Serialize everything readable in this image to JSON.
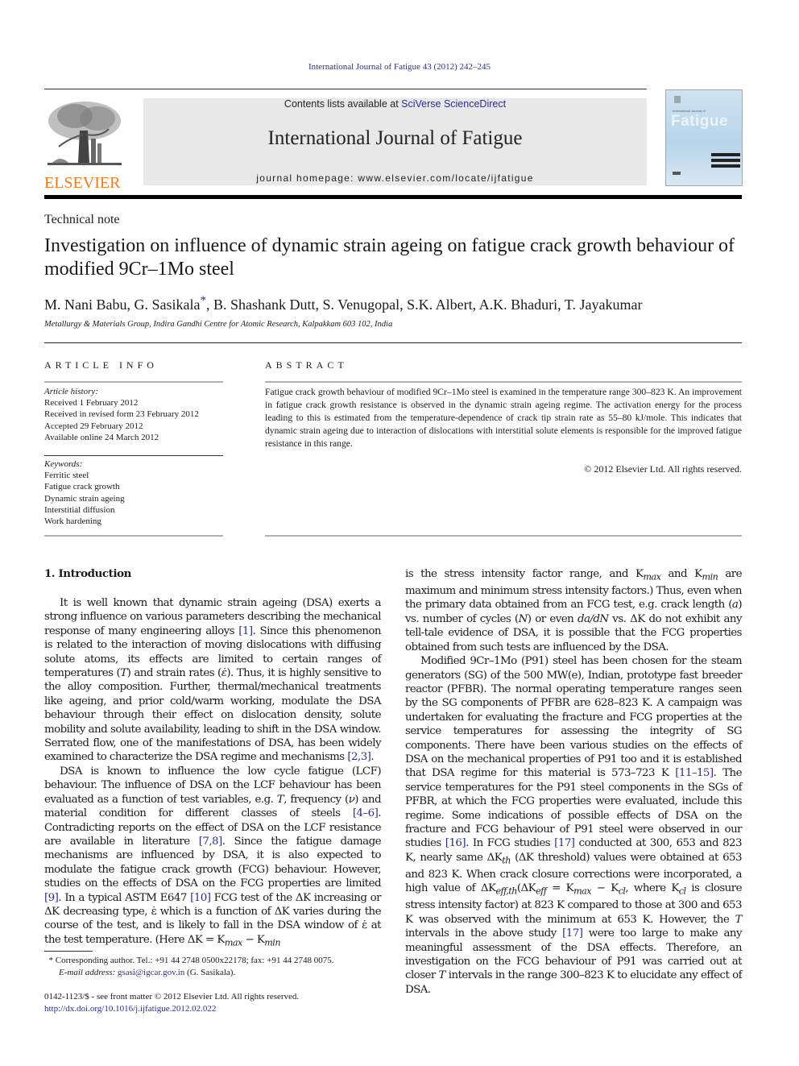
{
  "header": {
    "journal_reference": "International Journal of Fatigue 43 (2012) 242–245",
    "contents_prefix": "Contents lists available at ",
    "contents_link": "SciVerse ScienceDirect",
    "journal_title": "International Journal of Fatigue",
    "homepage": "journal homepage: www.elsevier.com/locate/ijfatigue",
    "publisher_logo_text": "ELSEVIER",
    "cover": {
      "small_title": "International Journal of",
      "big_title": "Fatigue"
    },
    "colors": {
      "link": "#2b2e8c",
      "elsevier_orange": "#f07c22",
      "banner_bg": "#e8e8e8"
    }
  },
  "article": {
    "type": "Technical note",
    "title": "Investigation on influence of dynamic strain ageing on fatigue crack growth behaviour of modified 9Cr–1Mo steel",
    "authors_before": "M. Nani Babu, G. Sasikala",
    "corresponding_mark": "*",
    "authors_after": ", B. Shashank Dutt, S. Venugopal, S.K. Albert, A.K. Bhaduri, T. Jayakumar",
    "affiliation": "Metallurgy & Materials Group, Indira Gandhi Centre for Atomic Research, Kalpakkam 603 102, India"
  },
  "article_info": {
    "heading": "ARTICLE INFO",
    "history_label": "Article history:",
    "history": [
      "Received 1 February 2012",
      "Received in revised form 23 February 2012",
      "Accepted 29 February 2012",
      "Available online 24 March 2012"
    ],
    "keywords_label": "Keywords:",
    "keywords": [
      "Ferritic steel",
      "Fatigue crack growth",
      "Dynamic strain ageing",
      "Interstitial diffusion",
      "Work hardening"
    ]
  },
  "abstract": {
    "heading": "ABSTRACT",
    "text": "Fatigue crack growth behaviour of modified 9Cr–1Mo steel is examined in the temperature range 300–823 K. An improvement in fatigue crack growth resistance is observed in the dynamic strain ageing regime. The activation energy for the process leading to this is estimated from the temperature-dependence of crack tip strain rate as 55–80 kJ/mole. This indicates that dynamic strain ageing due to interaction of dislocations with interstitial solute elements is responsible for the improved fatigue resistance in this range.",
    "copyright": "© 2012 Elsevier Ltd. All rights reserved."
  },
  "body": {
    "section_heading": "1. Introduction",
    "p1": [
      "It is well known that dynamic strain ageing (DSA) exerts a strong influence on various parameters describing the mechanical response of many engineering alloys ",
      "[1]",
      ". Since this phenomenon is related to the interaction of moving dislocations with diffusing solute atoms, its effects are limited to certain ranges of temperatures (",
      "T",
      ") and strain rates (",
      "ε̇",
      "). Thus, it is highly sensitive to the alloy composition. Further, thermal/mechanical treatments like ageing, and prior cold/warm working, modulate the DSA behaviour through their effect on dislocation density, solute mobility and solute availability, leading to shift in the DSA window. Serrated flow, one of the manifestations of DSA, has been widely examined to characterize the DSA regime and mechanisms ",
      "[2,3]",
      "."
    ],
    "p2": [
      "DSA is known to influence the low cycle fatigue (LCF) behaviour. The influence of DSA on the LCF behaviour has been evaluated as a function of test variables, e.g. ",
      "T",
      ", frequency (",
      "ν",
      ") and material condition for different classes of steels ",
      "[4–6]",
      ". Contradicting reports on the effect of DSA on the LCF resistance are available in literature ",
      "[7,8]",
      ". Since the fatigue damage mechanisms are influenced by DSA, it is also expected to modulate the fatigue crack growth (FCG) behaviour. However, studies on the effects of DSA on the FCG properties are limited ",
      "[9]",
      ". In a typical ASTM E647 ",
      "[10]",
      " FCG test of the ΔK increasing or ΔK decreasing type, ε̇ which is a function of ΔK varies during the course of the test, and is likely to fall in the DSA window of ε̇ at the test temperature. (Here ΔK = K",
      "max",
      " − K",
      "min"
    ],
    "p2_cont": [
      "is the stress intensity factor range, and K",
      "max",
      " and K",
      "min",
      " are maximum and minimum stress intensity factors.) Thus, even when the primary data obtained from an FCG test, e.g. crack length (",
      "a",
      ") vs. number of cycles (",
      "N",
      ") or even ",
      "da/dN",
      " vs. ΔK do not exhibit any tell-tale evidence of DSA, it is possible that the FCG properties obtained from such tests are influenced by the DSA."
    ],
    "p3": [
      "Modified 9Cr–1Mo (P91) steel has been chosen for the steam generators (SG) of the 500 MW(e), Indian, prototype fast breeder reactor (PFBR). The normal operating temperature ranges seen by the SG components of PFBR are 628–823 K. A campaign was undertaken for evaluating the fracture and FCG properties at the service temperatures for assessing the integrity of SG components. There have been various studies on the effects of DSA on the mechanical properties of P91 too and it is established that DSA regime for this material is 573–723 K ",
      "[11–15]",
      ". The service temperatures for the P91 steel components in the SGs of PFBR, at which the FCG properties were evaluated, include this regime. Some indications of possible effects of DSA on the fracture and FCG behaviour of P91 steel were observed in our studies ",
      "[16]",
      ". In FCG studies ",
      "[17]",
      " conducted at 300, 653 and 823 K, nearly same ΔK",
      "th",
      " (ΔK threshold) values were obtained at 653 and 823 K. When crack closure corrections were incorporated, a high value of ΔK",
      "eff,th",
      "(ΔK",
      "eff",
      " = K",
      "max",
      " − K",
      "cl",
      ", where K",
      "cl",
      " is closure stress intensity factor) at 823 K compared to those at 300 and 653 K was observed with the minimum at 653 K. However, the ",
      "T",
      " intervals in the above study ",
      "[17]",
      " were too large to make any meaningful assessment of the DSA effects. Therefore, an investigation on the FCG behaviour of P91 was carried out at closer ",
      "T",
      " intervals in the range 300–823 K to elucidate any effect of DSA."
    ]
  },
  "footnote": {
    "mark": "*",
    "line1": " Corresponding author. Tel.: +91 44 2748 0500x22178; fax: +91 44 2748 0075.",
    "email_label": "E-mail address: ",
    "email": "gsasi@igcar.gov.in",
    "email_suffix": " (G. Sasikala)."
  },
  "front_matter": {
    "issn_line": "0142-1123/$ - see front matter © 2012 Elsevier Ltd. All rights reserved.",
    "doi": "http://dx.doi.org/10.1016/j.ijfatigue.2012.02.022"
  }
}
